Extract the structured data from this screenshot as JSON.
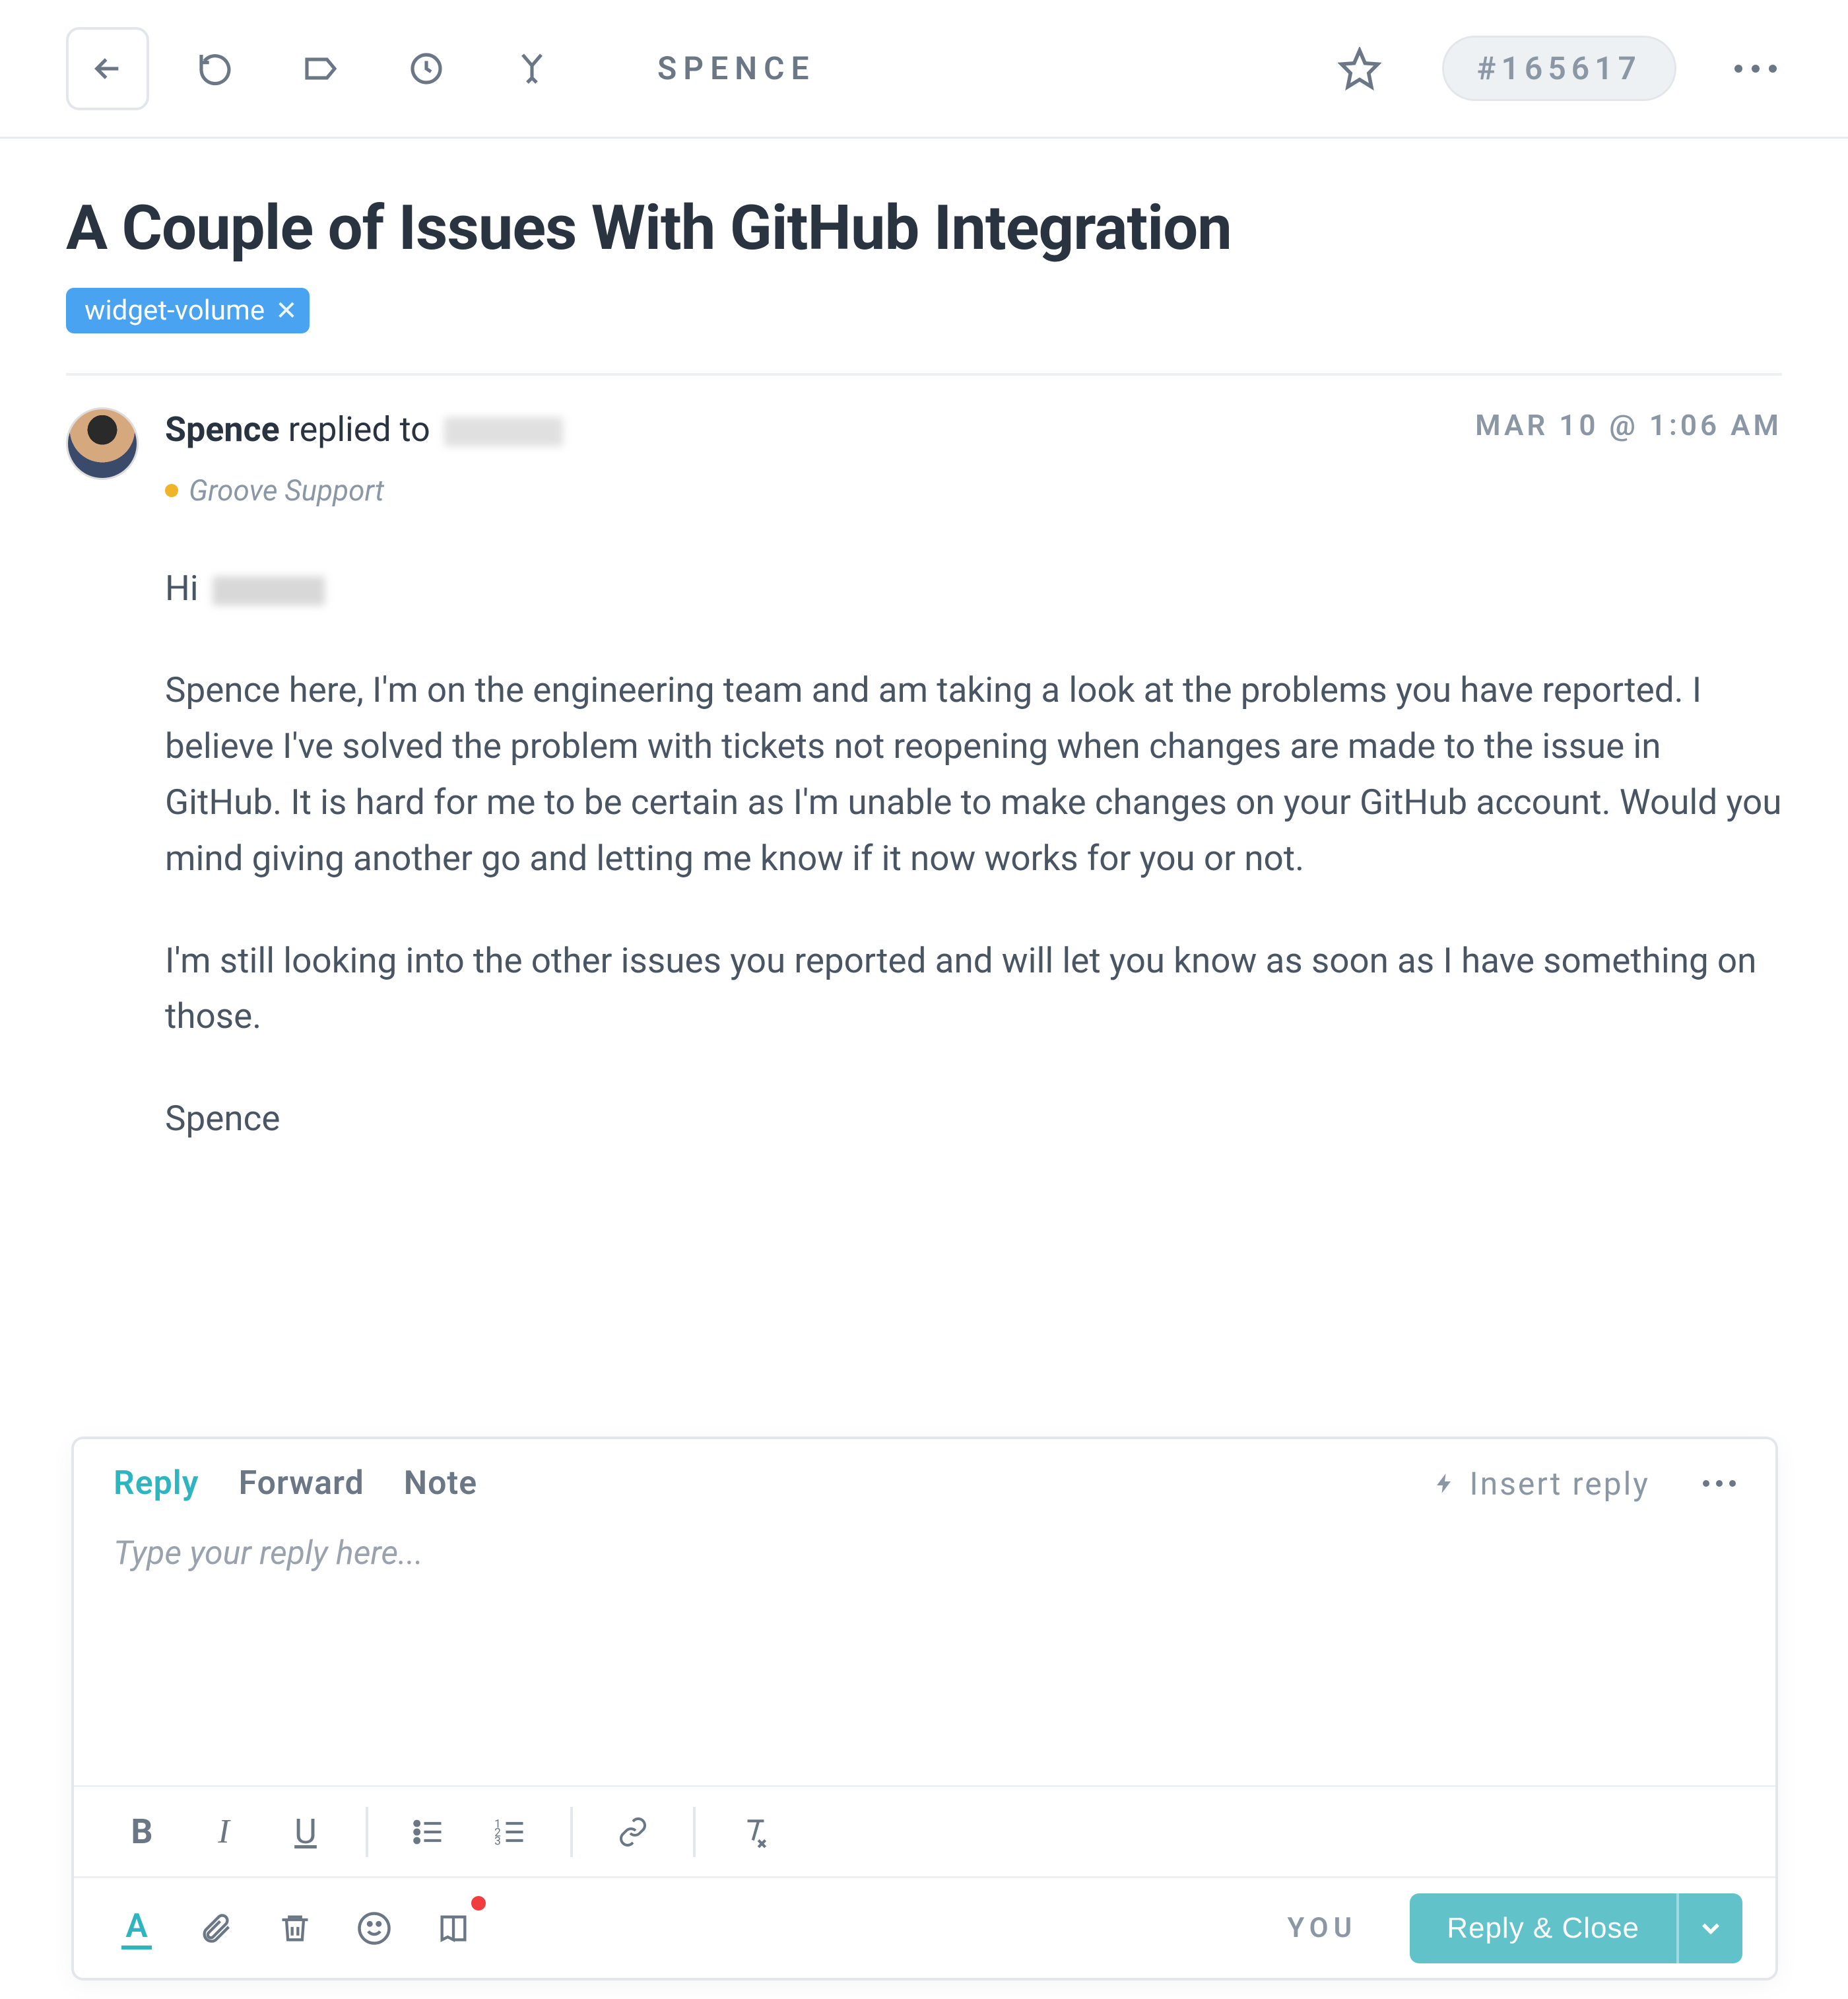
{
  "toolbar": {
    "assignee": "SPENCE",
    "ticket_id": "#165617"
  },
  "ticket": {
    "subject": "A Couple of Issues With GitHub Integration",
    "tags": [
      {
        "label": "widget-volume"
      }
    ]
  },
  "message": {
    "sender": "Spence",
    "action_text": " replied to ",
    "timestamp": "MAR 10 @ 1:06 AM",
    "mailbox": "Groove Support",
    "body_greeting": "Hi ",
    "body_p1": "Spence here, I'm on the engineering team and am taking a look at the problems you have reported. I believe I've solved the problem with tickets not reopening when changes are made to the issue in GitHub. It is hard for me to be certain as I'm unable to make changes on your GitHub account. Would you mind giving another go and letting me know if it now works for you or not.",
    "body_p2": "I'm still looking into the other issues you reported and will let you know as soon as I have something on those.",
    "body_signoff": "Spence"
  },
  "composer": {
    "tabs": {
      "reply": "Reply",
      "forward": "Forward",
      "note": "Note"
    },
    "insert_reply": "Insert reply",
    "placeholder": "Type your reply here...",
    "assigned_to_short": "YOU",
    "send_button": "Reply & Close"
  }
}
